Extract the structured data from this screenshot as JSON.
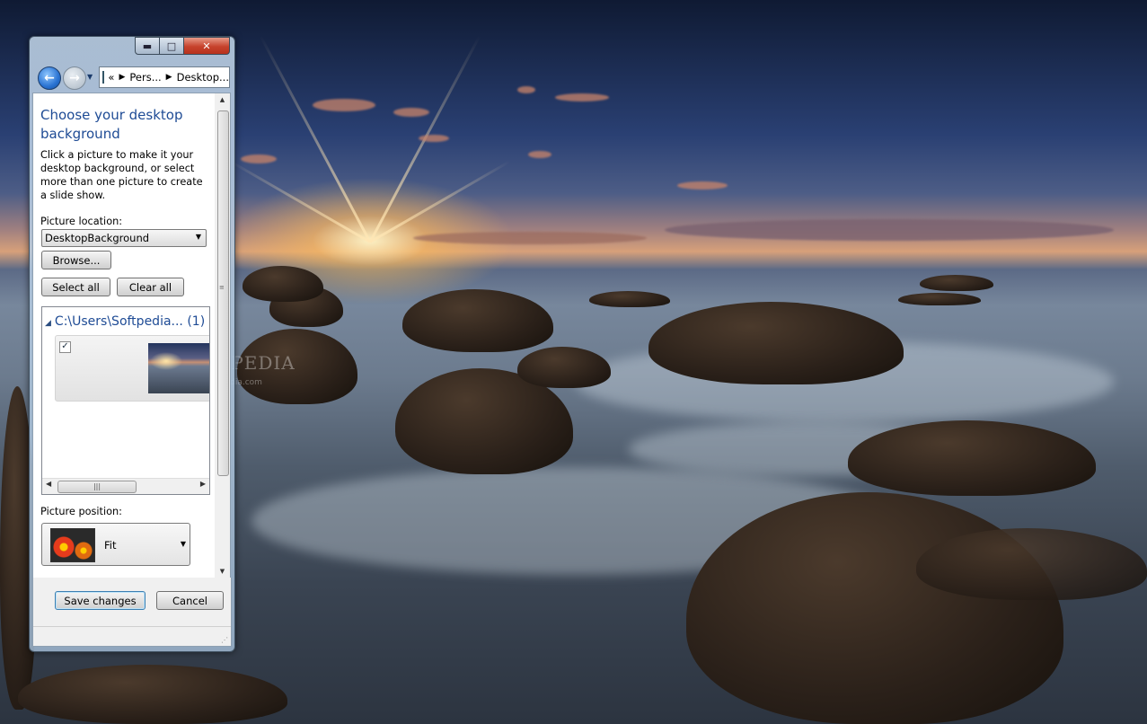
{
  "window": {
    "caption_buttons": {
      "minimize": "▬",
      "maximize": "□",
      "close": "✕"
    }
  },
  "nav": {
    "back_icon": "←",
    "forward_icon": "→",
    "history_dropdown_icon": "▼",
    "address": {
      "overflow": "«",
      "crumb1": "Pers...",
      "crumb2": "Desktop..."
    }
  },
  "page": {
    "title": "Choose your desktop background",
    "description": "Click a picture to make it your desktop background, or select more than one picture to create a slide show.",
    "picture_location_label": "Picture location:",
    "picture_location_value": "DesktopBackground",
    "browse_label": "Browse...",
    "select_all_label": "Select all",
    "clear_all_label": "Clear all",
    "group_header": "C:\\Users\\Softpedia... (1)",
    "picture_checked": "✓",
    "picture_position_label": "Picture position:",
    "picture_position_value": "Fit"
  },
  "footer": {
    "save_label": "Save changes",
    "cancel_label": "Cancel"
  },
  "wallpaper": {
    "watermark": "SOFTPEDIA",
    "watermark_url": "www.softpedia.com"
  }
}
